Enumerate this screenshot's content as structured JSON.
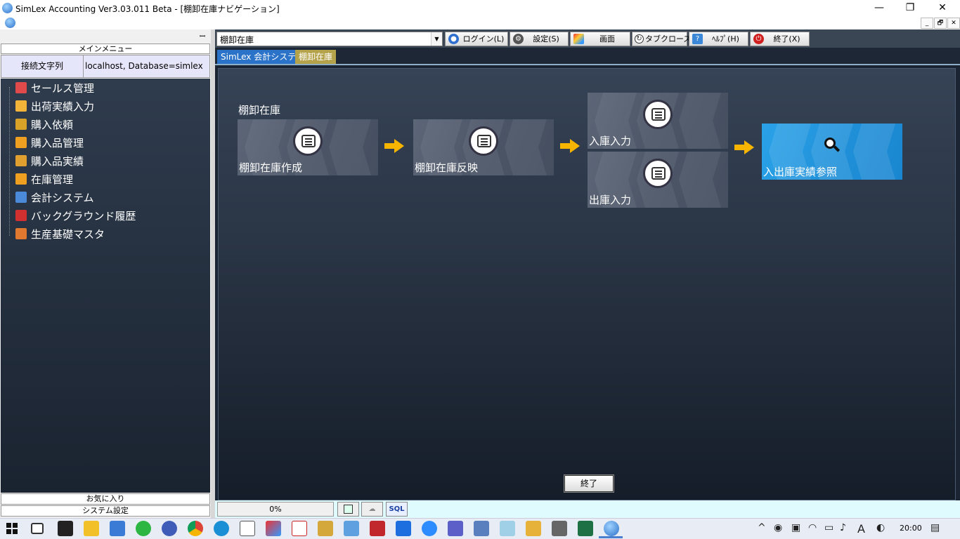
{
  "window": {
    "title": "SimLex Accounting Ver3.03.011 Beta - [棚卸在庫ナビゲーション]",
    "minimize": "—",
    "restore": "❐",
    "close": "✕",
    "mdi_minimize": "_",
    "mdi_restore": "🗗",
    "mdi_close": "✕"
  },
  "left_panel": {
    "pin": "ꟷ",
    "main_menu_label": "メインメニュー",
    "connection_label": "接続文字列",
    "connection_value": "localhost,  Database=simlex",
    "tree": [
      {
        "label": "セールス管理",
        "icon": "store-icon",
        "color": "#e04a4a"
      },
      {
        "label": "出荷実績入力",
        "icon": "box-icon",
        "color": "#f2b53a"
      },
      {
        "label": "購入依頼",
        "icon": "folder-icon",
        "color": "#d7a227"
      },
      {
        "label": "購入品管理",
        "icon": "cart-icon",
        "color": "#f0a020"
      },
      {
        "label": "購入品実績",
        "icon": "basket-icon",
        "color": "#e0a030"
      },
      {
        "label": "在庫管理",
        "icon": "magnifier-icon",
        "color": "#f0a020"
      },
      {
        "label": "会計システム",
        "icon": "bank-icon",
        "color": "#4a8ad8"
      },
      {
        "label": "バックグラウンド履歴",
        "icon": "clock-icon",
        "color": "#d03030"
      },
      {
        "label": "生産基礎マスタ",
        "icon": "database-icon",
        "color": "#e07830"
      }
    ],
    "favorites_label": "お気に入り",
    "system_settings_label": "システム設定"
  },
  "toolbar": {
    "combo_value": "棚卸在庫",
    "login_label": "ログイン(L)",
    "settings_label": "設定(S)",
    "screen_label": "画面",
    "tab_close_label": "タブクローズ",
    "help_label": "ﾍﾙﾌﾟ(H)",
    "exit_label": "終了(X)"
  },
  "tabs": [
    {
      "label": "SimLex 会計システム",
      "color": "#2b73c8"
    },
    {
      "label": "棚卸在庫",
      "color": "#b5a34c"
    }
  ],
  "navigation": {
    "section_title": "棚卸在庫",
    "tiles": {
      "create": "棚卸在庫作成",
      "reflect": "棚卸在庫反映",
      "stock_in": "入庫入力",
      "stock_out": "出庫入力",
      "history": "入出庫実績参照"
    },
    "exit_button": "終了"
  },
  "status": {
    "progress": "0%",
    "sql_label": "SQL"
  },
  "taskbar": {
    "clock": "20:00",
    "ime": "A"
  }
}
